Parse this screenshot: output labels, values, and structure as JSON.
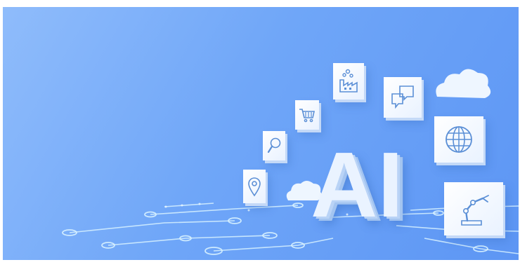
{
  "scene": {
    "colors": {
      "background_light": "#8fbcfb",
      "background_dark": "#5d96f4",
      "circuit": "#d8f2ff",
      "tile_face": "#ffffff",
      "icon_stroke": "#5b8fd6"
    },
    "title_text": "AI",
    "icons": [
      "location-pin-icon",
      "magnifier-icon",
      "shopping-cart-icon",
      "factory-icon",
      "chat-bubbles-icon",
      "globe-icon",
      "robot-arm-icon",
      "cloud-icon"
    ]
  }
}
